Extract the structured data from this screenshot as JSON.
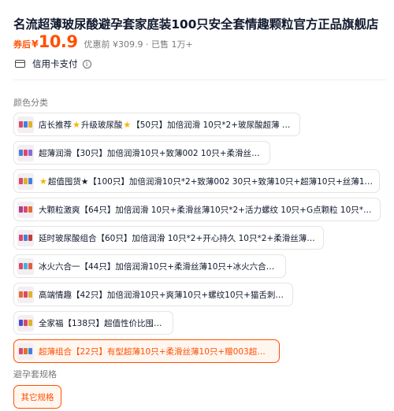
{
  "product": {
    "title": "名流超薄玻尿酸避孕套家庭装100只安全套情趣颗粒官方正品旗舰店",
    "price_prefix": "券后",
    "price_currency": "¥",
    "price_value": "10.9",
    "price_original": "优惠前 ¥309.9 · 已售 1万+",
    "payment_label": "信用卡支付",
    "info_icon_glyph": "i"
  },
  "colors": {
    "accent": "#ff5000",
    "selected_bg": "#fff6f0",
    "border": "#e4e4e4",
    "star": "#f6b400"
  },
  "icons": {
    "card": "credit-card-icon",
    "info": "info-icon",
    "star": "star-icon"
  },
  "sections": {
    "color_label": "颜色分类",
    "spec_label": "避孕套规格"
  },
  "skus": [
    {
      "pre": "店长推荐",
      "star1": "★",
      "mid": "升级玻尿酸",
      "star2": "★",
      "post": "【50只】加倍润滑 10只*2+玻尿酸超薄 30只",
      "selected": false
    },
    {
      "pre": "",
      "star1": "",
      "mid": "",
      "star2": "",
      "post": "超薄润滑【30只】加倍润滑10只+致薄002 10只+柔滑丝薄10只",
      "selected": false
    },
    {
      "pre": "",
      "star1": "★",
      "mid": "",
      "star2": "",
      "post": "超值囤货★【100只】加倍润滑10只*2+致薄002 30只+致薄10只+超薄10只+丝薄10只+…",
      "selected": false
    },
    {
      "pre": "",
      "star1": "",
      "mid": "",
      "star2": "",
      "post": "大颗粒激爽【64只】加倍润滑 10只+柔滑丝薄10只*2+活力螺纹 10只+G点颗粒 10只*2+大…",
      "selected": false
    },
    {
      "pre": "",
      "star1": "",
      "mid": "",
      "star2": "",
      "post": "延时玻尿酸组合【60只】加倍润滑 10只*2+开心持久 10只*2+柔滑丝薄 10只*2",
      "selected": false
    },
    {
      "pre": "",
      "star1": "",
      "mid": "",
      "star2": "",
      "post": "冰火六合一【44只】加倍润滑10只+柔滑丝薄10只+冰火六合一 24只",
      "selected": false
    },
    {
      "pre": "",
      "star1": "",
      "mid": "",
      "star2": "",
      "post": "高端情趣【42只】加倍润滑10只+爽薄10只+螺纹10只+猫舌刺套12只",
      "selected": false
    },
    {
      "pre": "",
      "star1": "",
      "mid": "",
      "star2": "",
      "post": "全家福【138只】超值性价比囤货装",
      "selected": false
    },
    {
      "pre": "",
      "star1": "",
      "mid": "",
      "star2": "",
      "post": "超薄组合【22只】有型超薄10只+柔滑丝薄10只+赠003超润薄2只",
      "selected": true
    }
  ],
  "spec": {
    "option_label": "其它规格"
  }
}
